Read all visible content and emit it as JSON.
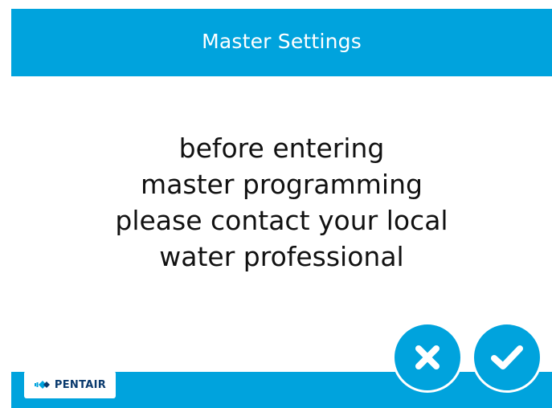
{
  "header": {
    "title": "Master Settings"
  },
  "message": {
    "lines": [
      "before entering",
      "master programming",
      "please contact your local",
      "water professional"
    ]
  },
  "footer": {
    "logo_text": "PENTAIR",
    "cancel_icon": "close-icon",
    "confirm_icon": "check-icon"
  },
  "colors": {
    "accent": "#00a3dd",
    "text": "#111111",
    "logo_text": "#0a3a6e"
  }
}
